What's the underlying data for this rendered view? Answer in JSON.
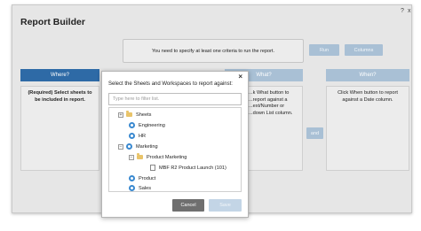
{
  "window": {
    "title": "Report Builder",
    "help_label": "?",
    "close_label": "x"
  },
  "notice": "You need to specify at least one criteria to run the report.",
  "toolbar": {
    "run_label": "Run",
    "columns_label": "Columns"
  },
  "columns": {
    "where": {
      "header": "Where?",
      "body": "(Required) Select sheets to be included in report."
    },
    "what": {
      "header": "What?",
      "body": "...k What button to ...report against a ...ext/Number or ...down List column."
    },
    "when": {
      "header": "When?",
      "body": "Click When button to report against a Date column."
    }
  },
  "and_label": "and",
  "dialog": {
    "close_label": "×",
    "label": "Select the Sheets and Workspaces to report against:",
    "filter_placeholder": "Type here to filter list.",
    "tree": [
      {
        "label": "Sheets",
        "icon": "folder",
        "expander": "+"
      },
      {
        "label": "Engineering",
        "icon": "workspace"
      },
      {
        "label": "HR",
        "icon": "workspace"
      },
      {
        "label": "Marketing",
        "icon": "workspace",
        "expander": "−"
      },
      {
        "label": "Product Marketing",
        "icon": "folder",
        "expander": "−"
      },
      {
        "label": "MBF R2 Product Launch (101)",
        "icon": "sheet"
      },
      {
        "label": "Product",
        "icon": "workspace"
      },
      {
        "label": "Sales",
        "icon": "workspace"
      }
    ],
    "cancel_label": "Cancel",
    "save_label": "Save"
  },
  "colors": {
    "primary": "#2e6aa6",
    "disabled_button": "#a9c0d5",
    "cancel_button": "#6f6f6f",
    "workspace_icon": "#3a89d0",
    "folder_icon": "#e9c46a"
  }
}
